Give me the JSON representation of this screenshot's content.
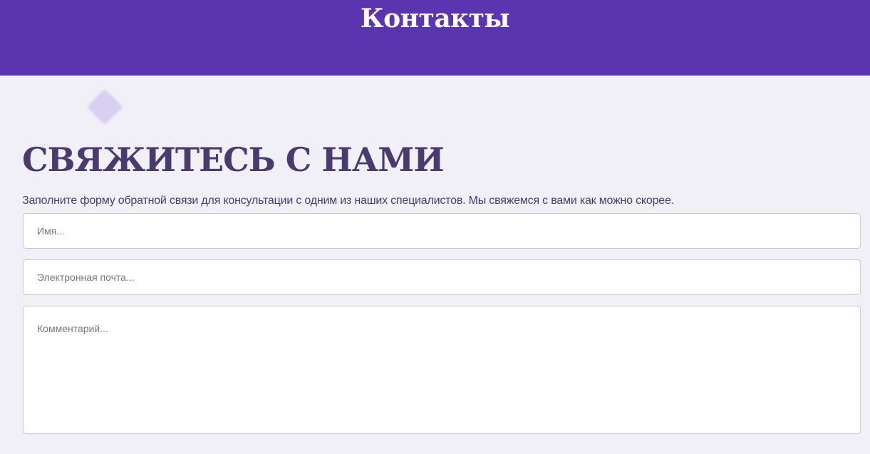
{
  "header": {
    "title": "Контакты"
  },
  "section": {
    "title": "СВЯЖИТЕСЬ С НАМИ",
    "description": "Заполните форму обратной связи для консультации с одним из наших специалистов. Мы свяжемся с вами как можно скорее."
  },
  "form": {
    "name_placeholder": "Имя...",
    "email_placeholder": "Электронная почта...",
    "comment_placeholder": "Комментарий..."
  },
  "colors": {
    "header_bg": "#5b35b0",
    "page_bg": "#f1f0f6",
    "heading_text": "#4a3a6e",
    "decor_diamond": "#d9d0f1"
  }
}
